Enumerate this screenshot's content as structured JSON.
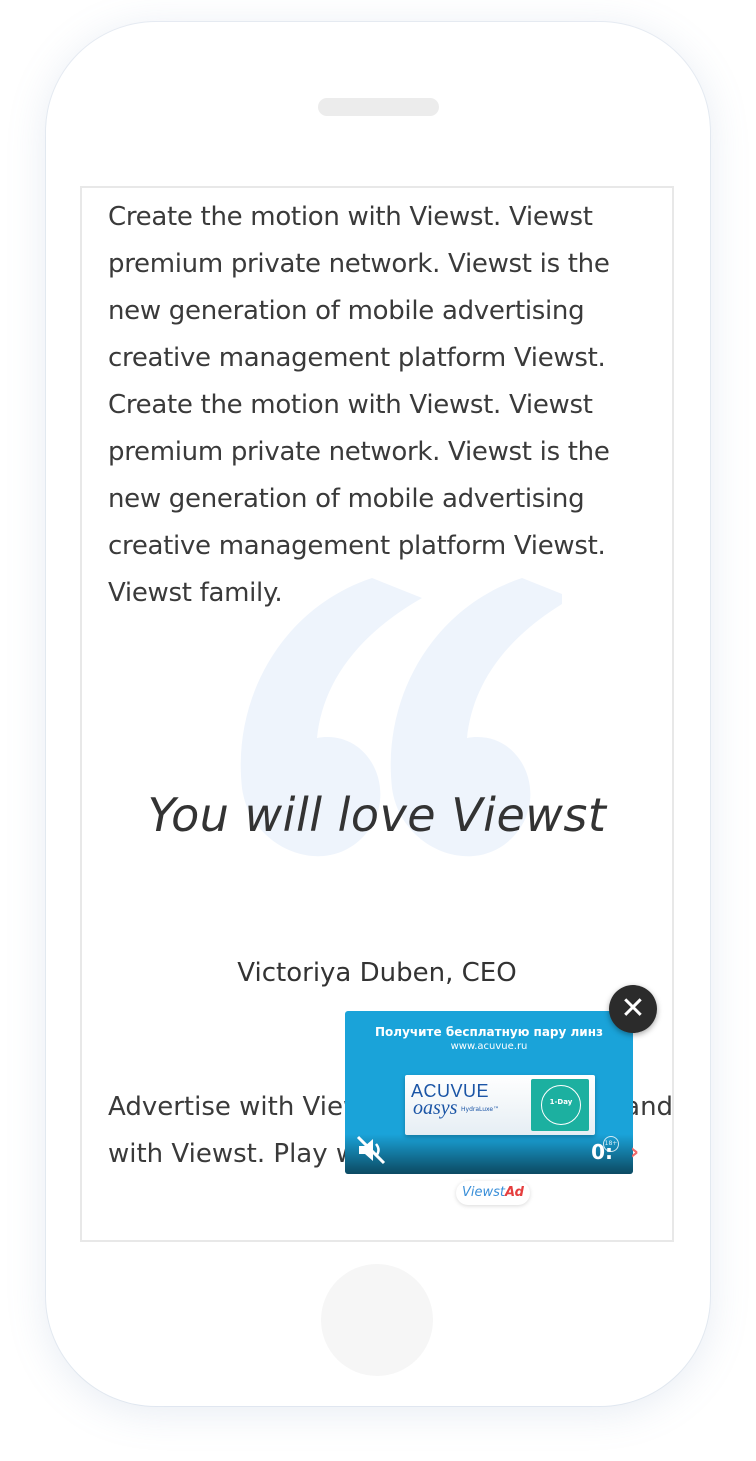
{
  "article": {
    "body_text": "Create the motion with Viewst. Viewst premium private network. Viewst is the new generation of mobile advertising creative management platform Viewst. Create the motion with Viewst. Viewst premium private network. Viewst is the new generation of mobile advertising creative management platform Viewst. Viewst family.",
    "quote_text": "You will love Viewst",
    "quote_author": "Victoriya Duben, CEO",
    "advertise_line_1": "Advertise with Viewst. Play with Viewst and",
    "advertise_line_2": "with Viewst. Play with Viewst."
  },
  "ad": {
    "headline": "Получите бесплатную пару линз",
    "url": "www.acuvue.ru",
    "brand_name": "ACUVUE",
    "brand_sub": "oasys",
    "brand_hydra": "HydraLuxe™",
    "day_label": "1-Day",
    "timer": "0:",
    "age_rating": "18+",
    "close_label": "✕",
    "next_label": "›",
    "badge_viewst": "Viewst",
    "badge_ad": "Ad"
  },
  "icons": [
    "close-icon",
    "mute-icon",
    "next-arrow-icon",
    "quote-mark-icon"
  ],
  "colors": {
    "ad_background": "#1aa3d9",
    "accent_red": "#e53e3e",
    "quote_mark": "#eef4fc"
  }
}
